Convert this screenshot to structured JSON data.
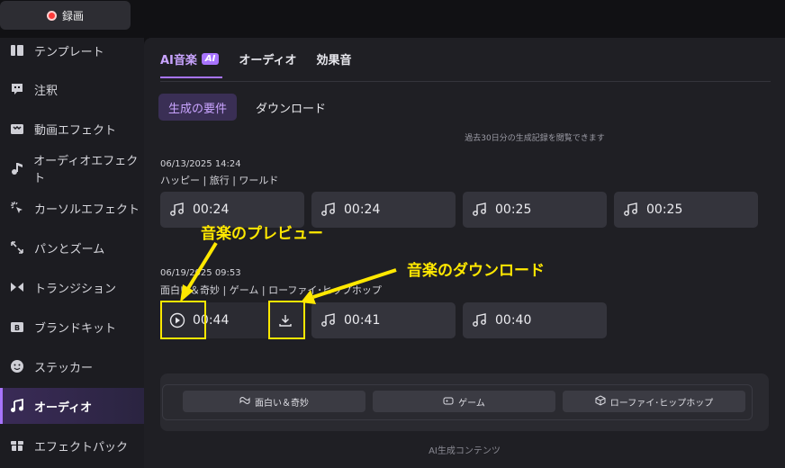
{
  "toolbar": {
    "record_label": "録画"
  },
  "sidebar": {
    "items": [
      {
        "label": "テンプレート",
        "icon": "template-icon"
      },
      {
        "label": "注釈",
        "icon": "annotation-icon"
      },
      {
        "label": "動画エフェクト",
        "icon": "video-effect-icon"
      },
      {
        "label": "オーディオエフェクト",
        "icon": "audio-effect-icon"
      },
      {
        "label": "カーソルエフェクト",
        "icon": "cursor-effect-icon"
      },
      {
        "label": "パンとズーム",
        "icon": "pan-zoom-icon"
      },
      {
        "label": "トランジション",
        "icon": "transition-icon"
      },
      {
        "label": "ブランドキット",
        "icon": "brand-kit-icon"
      },
      {
        "label": "ステッカー",
        "icon": "sticker-icon"
      },
      {
        "label": "オーディオ",
        "icon": "music-note-icon",
        "active": true
      },
      {
        "label": "エフェクトパック",
        "icon": "effect-pack-icon"
      }
    ]
  },
  "main": {
    "tabs": [
      {
        "label": "AI音楽",
        "badge": "AI",
        "active": true
      },
      {
        "label": "オーディオ"
      },
      {
        "label": "効果音"
      }
    ],
    "subtabs": [
      {
        "label": "生成の要件",
        "active": true
      },
      {
        "label": "ダウンロード"
      }
    ],
    "history_note": "過去30日分の生成記録を閲覧できます",
    "groups": [
      {
        "date": "06/13/2025 14:24",
        "tags": "ハッピー | 旅行 | ワールド",
        "tracks": [
          "00:24",
          "00:24",
          "00:25",
          "00:25"
        ]
      },
      {
        "date": "06/19/2025 09:53",
        "tags": "面白い＆奇妙 | ゲーム | ローファイ･ヒップホップ",
        "tracks": [
          "00:44",
          "00:41",
          "00:40"
        ]
      }
    ],
    "chips": [
      {
        "label": "面白い＆奇妙",
        "icon": "funny-icon"
      },
      {
        "label": "ゲーム",
        "icon": "game-icon"
      },
      {
        "label": "ローファイ･ヒップホップ",
        "icon": "cube-icon"
      }
    ],
    "footer": "AI生成コンテンツ"
  },
  "annotations": {
    "preview_label": "音楽のプレビュー",
    "download_label": "音楽のダウンロード",
    "color": "#ffe800"
  },
  "colors": {
    "accent": "#a874ff",
    "record": "#ff3b3b"
  }
}
